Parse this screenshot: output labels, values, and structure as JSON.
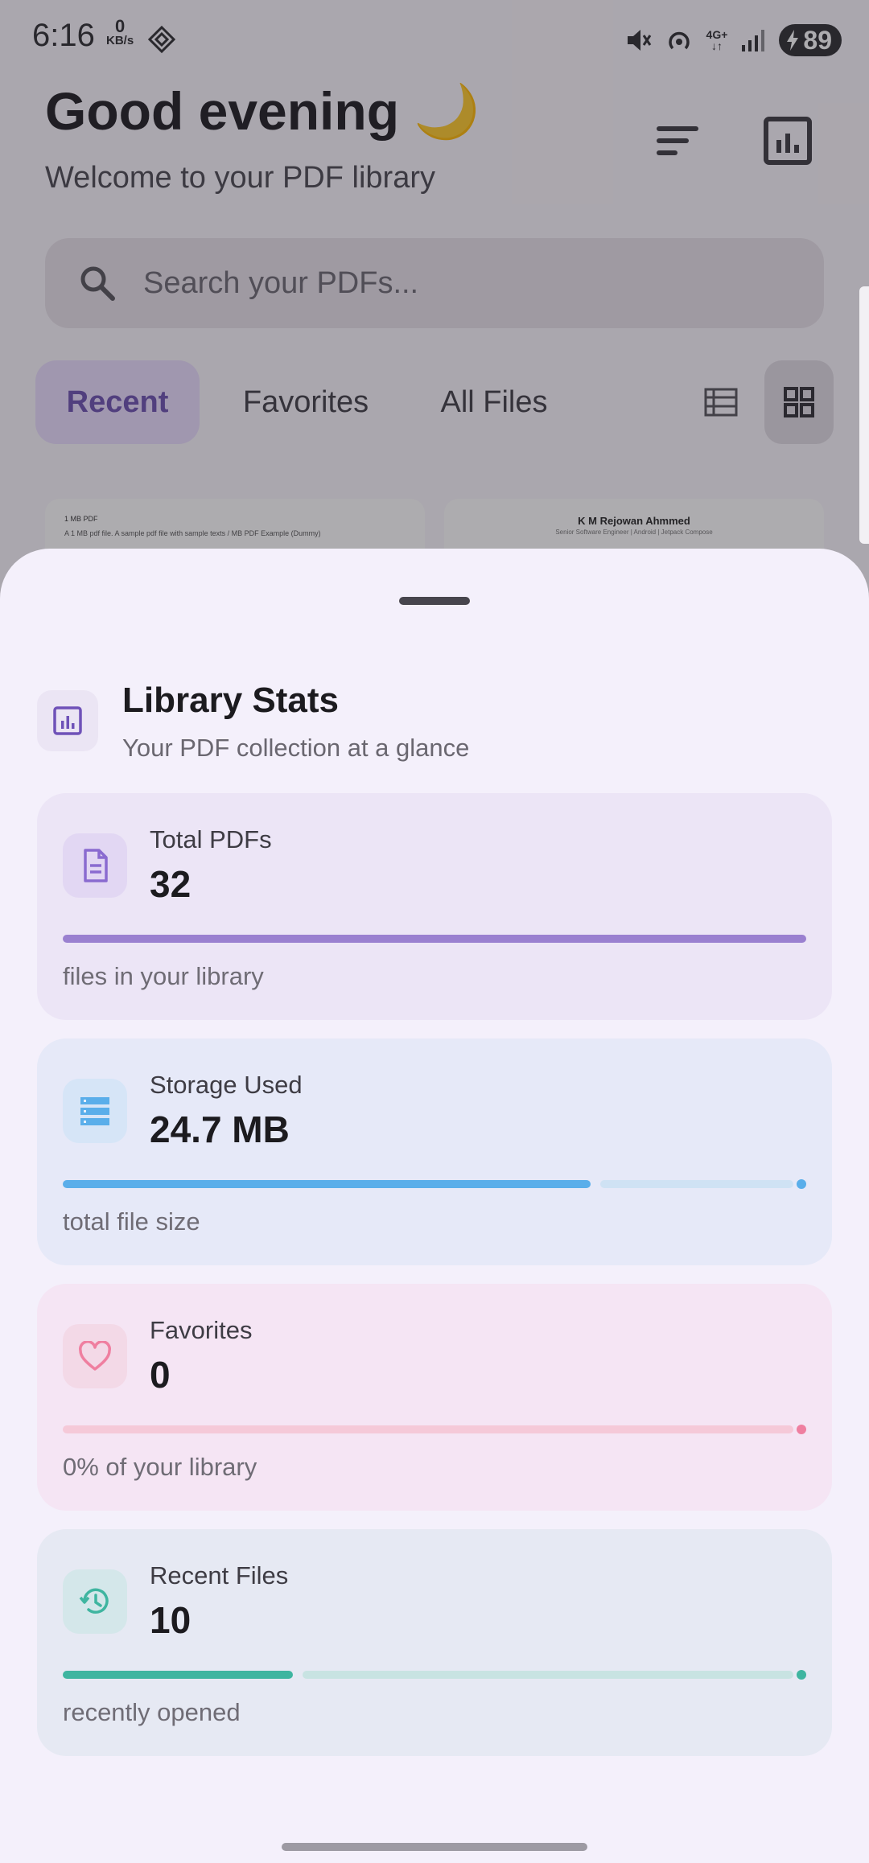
{
  "status_bar": {
    "time": "6:16",
    "net_speed_value": "0",
    "net_speed_unit": "KB/s",
    "network_label_top": "4G+",
    "battery": "89"
  },
  "header": {
    "greeting": "Good evening 🌙",
    "subtitle": "Welcome to your PDF library"
  },
  "search": {
    "placeholder": "Search your PDFs..."
  },
  "tabs": [
    {
      "label": "Recent",
      "active": true
    },
    {
      "label": "Favorites",
      "active": false
    },
    {
      "label": "All Files",
      "active": false
    }
  ],
  "thumbnails": [
    {
      "line1": "1 MB PDF",
      "line2": "A 1 MB pdf file. A sample pdf file with sample texts / MB PDF Example (Dummy)"
    },
    {
      "line1": "K M Rejowan Ahmmed",
      "line2": "Senior Software Engineer | Android | Jetpack Compose"
    }
  ],
  "sheet": {
    "title": "Library Stats",
    "subtitle": "Your PDF collection at a glance",
    "cards": [
      {
        "label": "Total PDFs",
        "value": "32",
        "desc": "files in your library",
        "progress": 1.0,
        "color": "#9a80d0",
        "track": "#d9cdef",
        "bg": "#ece5f6",
        "icon_bg": "#e2d7f3",
        "icon": "document-icon"
      },
      {
        "label": "Storage Used",
        "value": "24.7 MB",
        "desc": "total file size",
        "progress": 0.71,
        "color": "#5aaeea",
        "track": "#cfe2f4",
        "bg": "#e6e9f8",
        "icon_bg": "#d6e5f7",
        "icon": "storage-icon"
      },
      {
        "label": "Favorites",
        "value": "0",
        "desc": "0% of your library",
        "progress": 0.0,
        "color": "#ef7fa0",
        "track": "#f5c9d8",
        "bg": "#f5e5f4",
        "icon_bg": "#f3d9e7",
        "icon": "heart-icon"
      },
      {
        "label": "Recent Files",
        "value": "10",
        "desc": "recently opened",
        "progress": 0.31,
        "color": "#3fb5a0",
        "track": "#c8e3e2",
        "bg": "#e6e9f3",
        "icon_bg": "#d4e7ea",
        "icon": "history-icon"
      }
    ]
  }
}
